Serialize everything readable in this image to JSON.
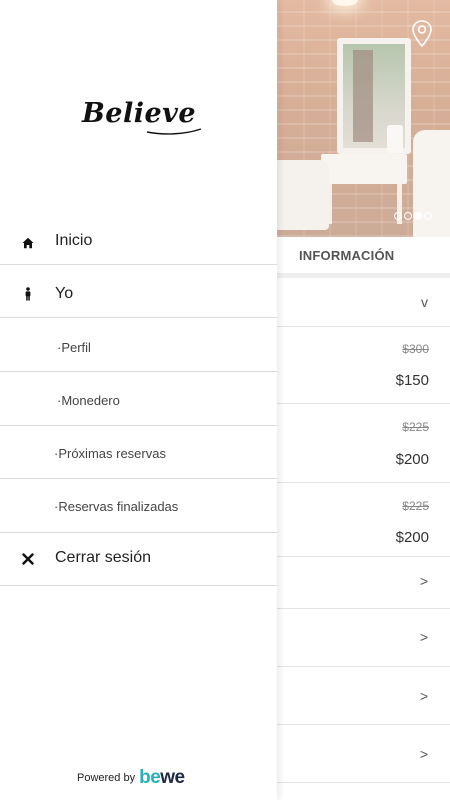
{
  "brand": {
    "logo_text": "Believe",
    "powered_by": "Powered by",
    "powered_brand_part1": "be",
    "powered_brand_part2": "we",
    "accent_color": "#2ab0b8"
  },
  "drawer": {
    "items": [
      {
        "label": "Inicio",
        "icon": "home-icon"
      },
      {
        "label": "Yo",
        "icon": "person-icon"
      },
      {
        "label": "·Perfil"
      },
      {
        "label": "·Monedero"
      },
      {
        "label": "·Próximas reservas"
      },
      {
        "label": "·Reservas finalizadas"
      },
      {
        "label": "Cerrar sesión",
        "icon": "close-icon"
      }
    ]
  },
  "background": {
    "section_title": "INFORMACIÓN",
    "carousel": {
      "pages": 4,
      "active": 3
    },
    "expand_symbol": "v",
    "prices": [
      {
        "old": "$300",
        "new": "$150"
      },
      {
        "old": "$225",
        "new": "$200"
      },
      {
        "old": "$225",
        "new": "$200"
      }
    ],
    "arrow_symbol": ">"
  }
}
